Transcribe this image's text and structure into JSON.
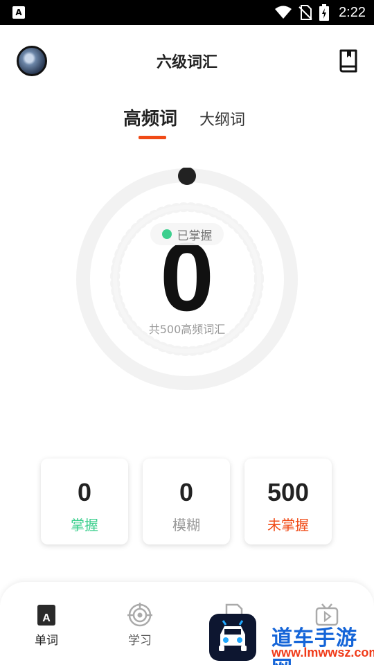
{
  "statusbar": {
    "time": "2:22"
  },
  "header": {
    "title": "六级词汇"
  },
  "tabs": [
    {
      "label": "高频词",
      "active": true
    },
    {
      "label": "大纲词",
      "active": false
    }
  ],
  "progress": {
    "status_label": "已掌握",
    "mastered_count": "0",
    "subtitle": "共500高频词汇",
    "fraction_mastered": 0
  },
  "stats": [
    {
      "value": "0",
      "label": "掌握",
      "color": "#3ccf8e"
    },
    {
      "value": "0",
      "label": "模糊",
      "color": "#999999"
    },
    {
      "value": "500",
      "label": "未掌握",
      "color": "#f04a16"
    }
  ],
  "nav": [
    {
      "label": "单词",
      "icon": "word-book-icon",
      "active": true
    },
    {
      "label": "学习",
      "icon": "target-icon",
      "active": false
    }
  ],
  "watermark": {
    "title": "道车手游网",
    "url": "www.lmwwsz.com"
  },
  "colors": {
    "accent": "#f04a16",
    "mastered": "#3ccf8e",
    "status_bar": "#000000"
  }
}
